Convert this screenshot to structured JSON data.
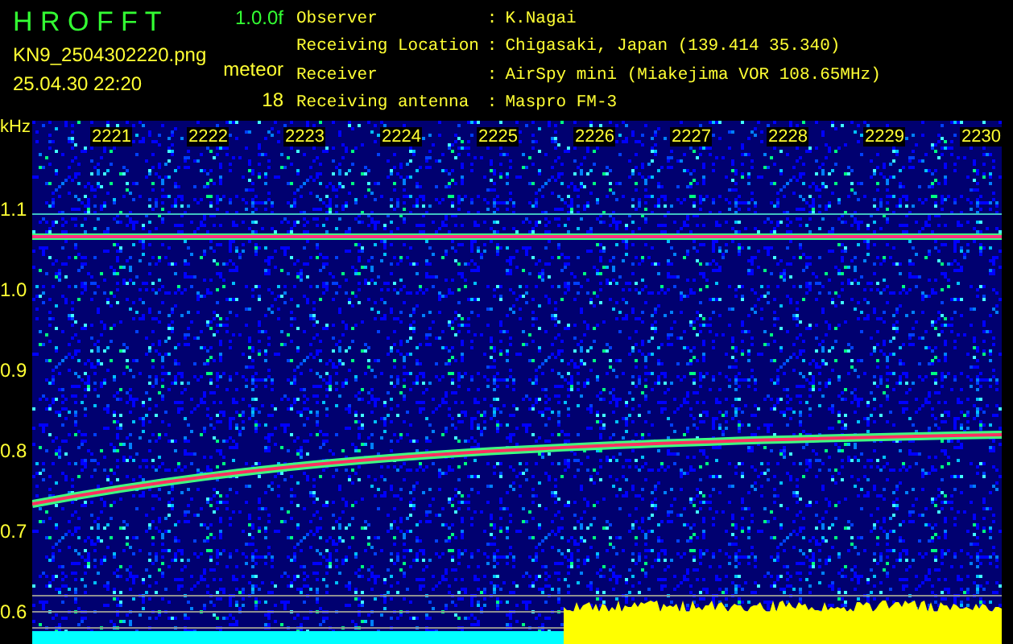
{
  "header": {
    "app_name": "H R O F F T",
    "version": "1.0.0f",
    "filename": "KN9_2504302220.png",
    "timestamp": "25.04.30 22:20",
    "count_label": "meteor",
    "count": "18"
  },
  "info": [
    {
      "label": "Observer",
      "separator": ":",
      "value": "K.Nagai"
    },
    {
      "label": "Receiving Location",
      "separator": ":",
      "value": "Chigasaki, Japan (139.414 35.340)"
    },
    {
      "label": "Receiver",
      "separator": ":",
      "value": "AirSpy mini (Miakejima VOR 108.65MHz)"
    },
    {
      "label": "Receiving antenna",
      "separator": ":",
      "value": "Maspro FM-3"
    }
  ],
  "spectrogram": {
    "unit": "kHz",
    "time_ticks": [
      "2221",
      "2222",
      "2223",
      "2224",
      "2225",
      "2226",
      "2227",
      "2228",
      "2229",
      "2230"
    ],
    "freq_ticks": [
      "1.1",
      "1.0",
      "0.9",
      "0.8",
      "0.7",
      "0.6"
    ]
  }
}
